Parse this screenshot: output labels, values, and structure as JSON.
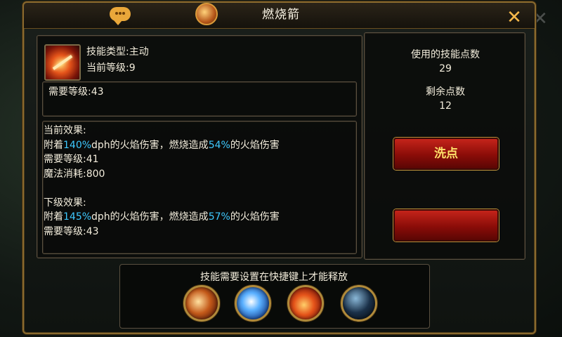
{
  "dialog": {
    "title": "燃烧箭",
    "close_glyph": "✕"
  },
  "skill": {
    "type_label": "技能类型:主动",
    "current_level_label": "当前等级:9",
    "required_level_label": "需要等级:43"
  },
  "effects": {
    "current_header": "当前效果:",
    "current_line1": {
      "a": "附着",
      "pct1": "140%",
      "b": "dph的火焰伤害，燃烧造成",
      "pct2": "54%",
      "c": "的火焰伤害"
    },
    "current_req_level": "需要等级:41",
    "current_mana": "魔法消耗:800",
    "next_header": "下级效果:",
    "next_line1": {
      "a": "附着",
      "pct1": "145%",
      "b": "dph的火焰伤害，燃烧造成",
      "pct2": "57%",
      "c": "的火焰伤害"
    },
    "next_req_level": "需要等级:43"
  },
  "points": {
    "used_label": "使用的技能点数",
    "used_value": "29",
    "remaining_label": "剩余点数",
    "remaining_value": "12",
    "reset_button": "洗点"
  },
  "hotbar": {
    "hint": "技能需要设置在快捷键上才能释放",
    "slots": [
      "flame-arrow-slot",
      "ice-burst-slot",
      "fire-arrow-slot",
      "dark-orb-slot"
    ]
  },
  "colors": {
    "highlight": "#3ec9ff",
    "frame_gold": "#8a6a2e",
    "button_red": "#c4241a",
    "button_text": "#ffe26a"
  }
}
